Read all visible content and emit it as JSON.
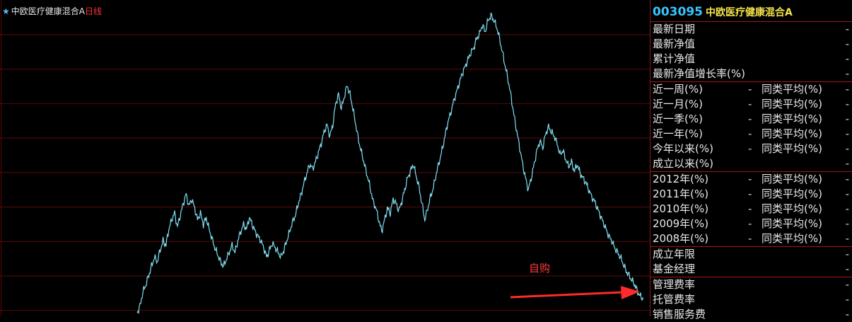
{
  "chart": {
    "star": "★",
    "fund_name": "中欧医疗健康混合A",
    "period_label": "日线",
    "annotation": "自购",
    "line_color": "#7fe0f2",
    "grid_color": "#5a0a0a",
    "arrow_color": "#ff2a2a"
  },
  "chart_data": {
    "type": "line",
    "title": "",
    "series": [
      {
        "values": [
          0.02,
          0.05,
          0.11,
          0.14,
          0.18,
          0.22,
          0.26,
          0.24,
          0.29,
          0.33,
          0.31,
          0.38,
          0.42,
          0.45,
          0.39,
          0.44,
          0.49,
          0.53,
          0.48,
          0.51,
          0.47,
          0.42,
          0.45,
          0.4,
          0.43,
          0.38,
          0.34,
          0.3,
          0.27,
          0.24,
          0.22,
          0.25,
          0.28,
          0.31,
          0.28,
          0.33,
          0.37,
          0.4,
          0.38,
          0.43,
          0.4,
          0.37,
          0.35,
          0.33,
          0.3,
          0.26,
          0.29,
          0.32,
          0.3,
          0.28,
          0.26,
          0.29,
          0.33,
          0.37,
          0.41,
          0.44,
          0.49,
          0.53,
          0.58,
          0.62,
          0.66,
          0.64,
          0.67,
          0.71,
          0.75,
          0.8,
          0.83,
          0.78,
          0.83,
          0.92,
          0.96,
          0.9,
          0.95,
          1.0,
          0.96,
          0.9,
          0.83,
          0.76,
          0.71,
          0.66,
          0.61,
          0.56,
          0.5,
          0.47,
          0.42,
          0.37,
          0.42,
          0.47,
          0.45,
          0.51,
          0.49,
          0.46,
          0.5,
          0.55,
          0.6,
          0.63,
          0.66,
          0.61,
          0.56,
          0.49,
          0.42,
          0.47,
          0.52,
          0.56,
          0.62,
          0.67,
          0.72,
          0.78,
          0.84,
          0.88,
          0.93,
          0.97,
          1.01,
          1.05,
          1.08,
          1.11,
          1.14,
          1.16,
          1.2,
          1.22,
          1.26,
          1.23,
          1.28,
          1.3,
          1.28,
          1.25,
          1.2,
          1.14,
          1.08,
          1.02,
          0.95,
          0.87,
          0.8,
          0.73,
          0.66,
          0.6,
          0.55,
          0.6,
          0.66,
          0.72,
          0.76,
          0.73,
          0.79,
          0.82,
          0.8,
          0.78,
          0.75,
          0.7,
          0.72,
          0.68,
          0.65,
          0.67,
          0.63,
          0.66,
          0.62,
          0.6,
          0.58,
          0.55,
          0.52,
          0.5,
          0.47,
          0.44,
          0.41,
          0.38,
          0.35,
          0.33,
          0.3,
          0.28,
          0.26,
          0.23,
          0.2,
          0.18,
          0.16,
          0.14,
          0.11,
          0.09,
          0.08
        ]
      }
    ]
  },
  "panel": {
    "code": "003095",
    "name": "中欧医疗健康混合A",
    "dash": "-",
    "sec1": [
      "最新日期",
      "最新净值",
      "累计净值",
      "最新净值增长率(%)"
    ],
    "sec2": [
      {
        "label": "近一周(%)",
        "v1": "-",
        "l2": "同类平均(%)",
        "v2": "-"
      },
      {
        "label": "近一月(%)",
        "v1": "-",
        "l2": "同类平均(%)",
        "v2": "-"
      },
      {
        "label": "近一季(%)",
        "v1": "-",
        "l2": "同类平均(%)",
        "v2": "-"
      },
      {
        "label": "近一年(%)",
        "v1": "-",
        "l2": "同类平均(%)",
        "v2": "-"
      },
      {
        "label": "今年以来(%)",
        "v1": "-",
        "l2": "同类平均(%)",
        "v2": "-"
      },
      {
        "label": "成立以来(%)",
        "v1": "",
        "l2": "",
        "v2": "-"
      }
    ],
    "sec3": [
      {
        "label": "2012年(%)",
        "v1": "-",
        "l2": "同类平均(%)",
        "v2": "-"
      },
      {
        "label": "2011年(%)",
        "v1": "-",
        "l2": "同类平均(%)",
        "v2": "-"
      },
      {
        "label": "2010年(%)",
        "v1": "-",
        "l2": "同类平均(%)",
        "v2": "-"
      },
      {
        "label": "2009年(%)",
        "v1": "-",
        "l2": "同类平均(%)",
        "v2": "-"
      },
      {
        "label": "2008年(%)",
        "v1": "-",
        "l2": "同类平均(%)",
        "v2": "-"
      }
    ],
    "sec4": [
      "成立年限",
      "基金经理"
    ],
    "sec5": [
      "管理费率",
      "托管费率",
      "销售服务费"
    ]
  }
}
